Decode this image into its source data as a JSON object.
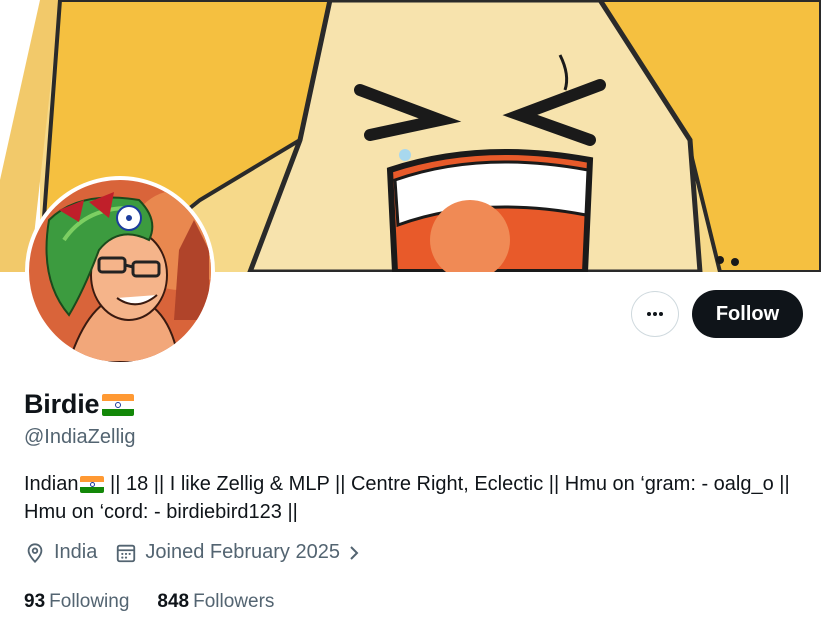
{
  "profile": {
    "display_name": "Birdie",
    "handle": "@IndiaZellig",
    "bio_line1_a": "Indian",
    "bio_line1_b": " || 18 || I like Zellig & MLP || Centre Right, Eclectic || Hmu on ‘gram: - oalg_o ||",
    "bio_line2": "Hmu on ‘cord: - birdiebird123 ||",
    "location": "India",
    "joined": "Joined February 2025",
    "following_count": "93",
    "following_label": "Following",
    "followers_count": "848",
    "followers_label": "Followers"
  },
  "actions": {
    "follow_label": "Follow"
  },
  "icons": {
    "more": "more-horizontal-icon",
    "location": "location-pin-icon",
    "calendar": "calendar-icon",
    "chevron": "chevron-right-icon"
  },
  "colors": {
    "follow_bg": "#0f1419",
    "secondary_text": "#536471",
    "flag_saffron": "#ff9933",
    "flag_green": "#138808",
    "flag_chakra": "#1c3c9c"
  }
}
